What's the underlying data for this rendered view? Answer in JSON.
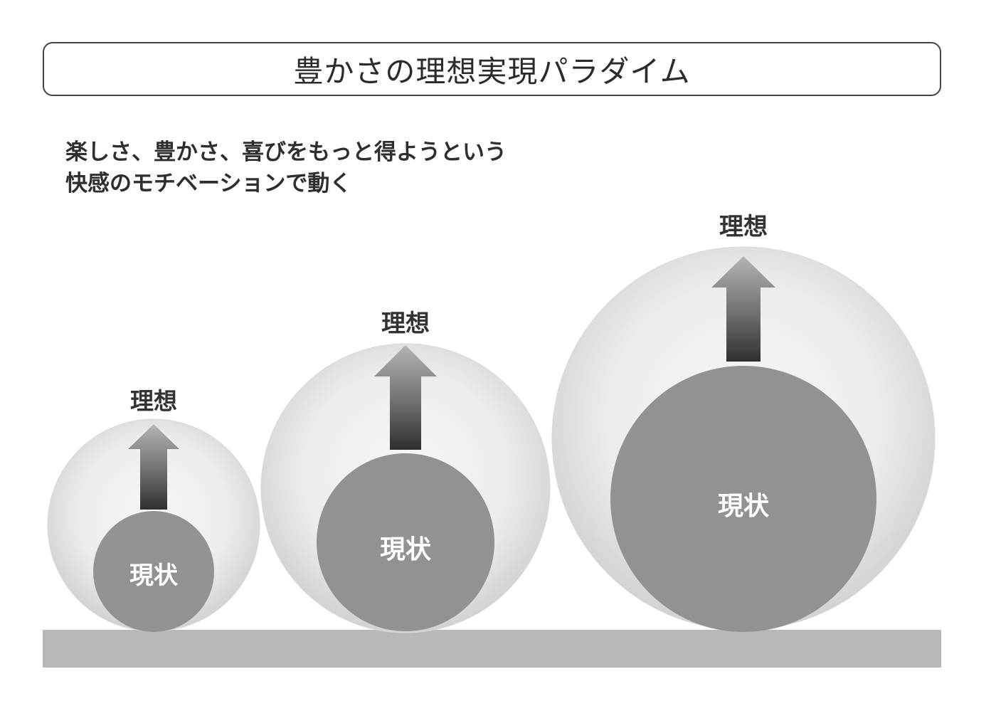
{
  "title": "豊かさの理想実現パラダイム",
  "subtitle": {
    "line1": "楽しさ、豊かさ、喜びをもっと得ようという",
    "line2": "快感のモチベーションで動く"
  },
  "stages": [
    {
      "ideal_label": "理想",
      "current_label": "現状"
    },
    {
      "ideal_label": "理想",
      "current_label": "現状"
    },
    {
      "ideal_label": "理想",
      "current_label": "現状"
    }
  ]
}
